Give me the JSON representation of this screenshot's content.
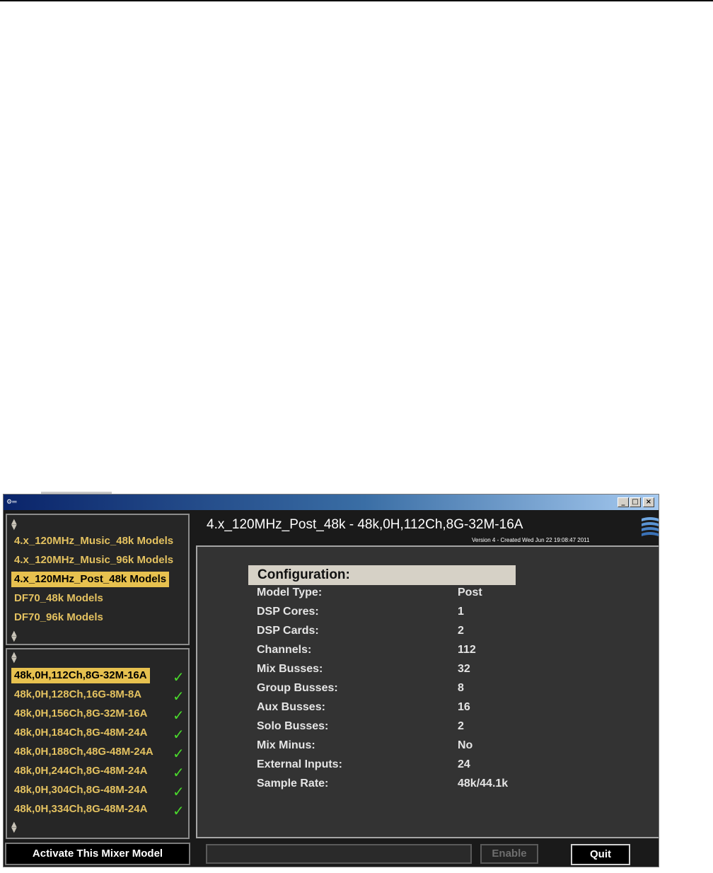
{
  "window": {
    "app_icon": "⚙═",
    "controls": {
      "minimize": "_",
      "maximize": "□",
      "close": "×"
    }
  },
  "model_groups": {
    "items": [
      {
        "label": "4.x_120MHz_Music_48k Models",
        "selected": false
      },
      {
        "label": "4.x_120MHz_Music_96k Models",
        "selected": false
      },
      {
        "label": "4.x_120MHz_Post_48k Models",
        "selected": true
      },
      {
        "label": "DF70_48k Models",
        "selected": false
      },
      {
        "label": "DF70_96k Models",
        "selected": false
      }
    ]
  },
  "models": {
    "items": [
      {
        "label": "48k,0H,112Ch,8G-32M-16A",
        "selected": true
      },
      {
        "label": "48k,0H,128Ch,16G-8M-8A",
        "selected": false
      },
      {
        "label": "48k,0H,156Ch,8G-32M-16A",
        "selected": false
      },
      {
        "label": "48k,0H,184Ch,8G-48M-24A",
        "selected": false
      },
      {
        "label": "48k,0H,188Ch,48G-48M-24A",
        "selected": false
      },
      {
        "label": "48k,0H,244Ch,8G-48M-24A",
        "selected": false
      },
      {
        "label": "48k,0H,304Ch,8G-48M-24A",
        "selected": false
      },
      {
        "label": "48k,0H,334Ch,8G-48M-24A",
        "selected": false
      }
    ],
    "check_glyph": "✓"
  },
  "header": {
    "title": "4.x_120MHz_Post_48k - 48k,0H,112Ch,8G-32M-16A",
    "version": "Version 4 - Created Wed Jun 22 19:08:47 2011"
  },
  "config": {
    "heading": "Configuration:",
    "rows": [
      {
        "label": "Model Type:",
        "value": "Post"
      },
      {
        "label": "DSP Cores:",
        "value": "1"
      },
      {
        "label": "DSP Cards:",
        "value": "2"
      },
      {
        "label": "Channels:",
        "value": "112"
      },
      {
        "label": "Mix Busses:",
        "value": "32"
      },
      {
        "label": "Group Busses:",
        "value": "8"
      },
      {
        "label": "Aux Busses:",
        "value": "16"
      },
      {
        "label": "Solo Busses:",
        "value": "2"
      },
      {
        "label": "Mix Minus:",
        "value": "No"
      },
      {
        "label": "External Inputs:",
        "value": "24"
      },
      {
        "label": "Sample Rate:",
        "value": "48k/44.1k"
      }
    ]
  },
  "buttons": {
    "activate": "Activate This Mixer Model",
    "enable": "Enable",
    "quit": "Quit"
  },
  "icons": {
    "scroll_up": "up-down-scroll-icon",
    "logo": "waves-logo-icon"
  },
  "colors": {
    "accent": "#e7c14f",
    "list_text": "#e3c160",
    "check": "#4ad82c"
  }
}
